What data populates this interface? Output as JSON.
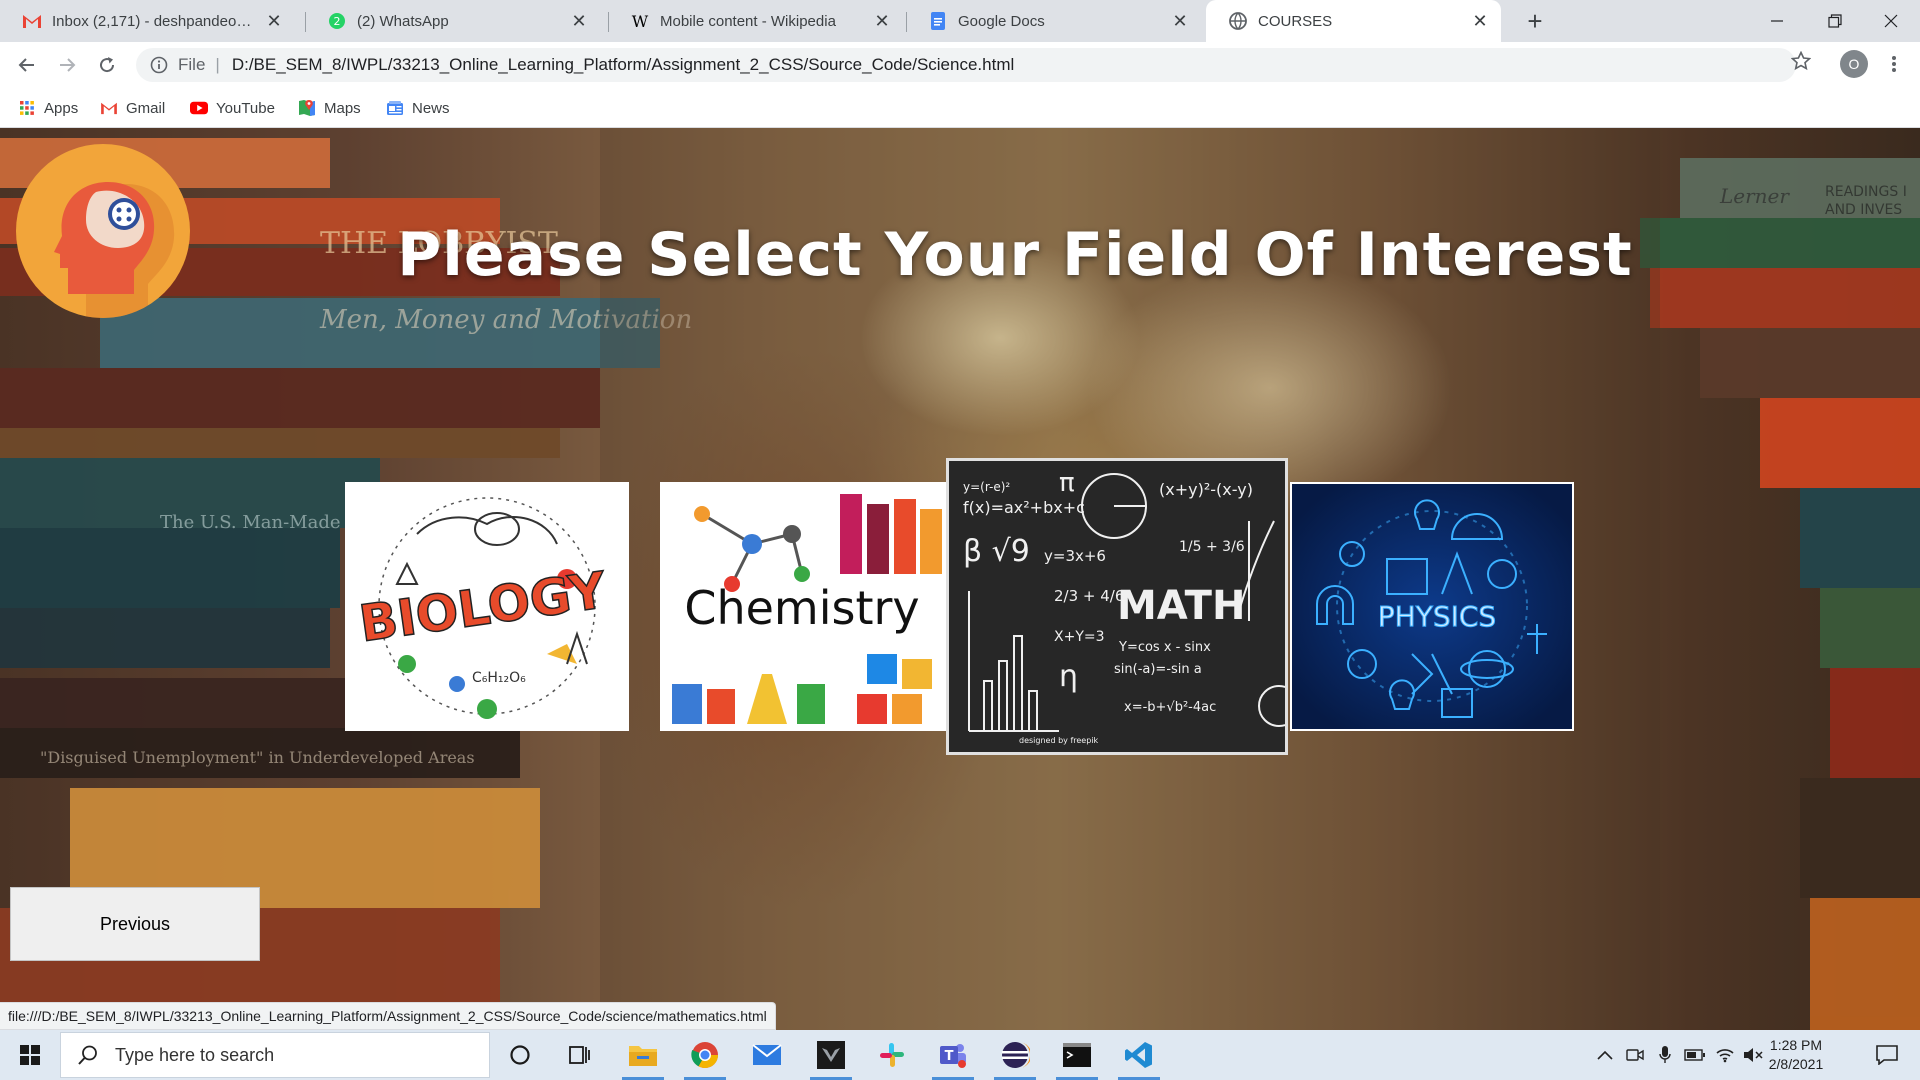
{
  "browser": {
    "tabs": [
      {
        "title": "Inbox (2,171) - deshpandeomkar",
        "icon": "gmail-icon"
      },
      {
        "title": "(2) WhatsApp",
        "icon": "whatsapp-icon"
      },
      {
        "title": "Mobile content - Wikipedia",
        "icon": "wikipedia-icon"
      },
      {
        "title": "Google Docs",
        "icon": "google-docs-icon"
      },
      {
        "title": "COURSES",
        "icon": "globe-icon",
        "active": true
      }
    ],
    "address": {
      "scheme": "File",
      "url": "D:/BE_SEM_8/IWPL/33213_Online_Learning_Platform/Assignment_2_CSS/Source_Code/Science.html"
    },
    "profile_initial": "O",
    "bookmarks": [
      {
        "label": "Apps",
        "icon": "apps-grid-icon"
      },
      {
        "label": "Gmail",
        "icon": "gmail-icon"
      },
      {
        "label": "YouTube",
        "icon": "youtube-icon"
      },
      {
        "label": "Maps",
        "icon": "maps-icon"
      },
      {
        "label": "News",
        "icon": "news-icon"
      }
    ],
    "status_url": "file:///D:/BE_SEM_8/IWPL/33213_Online_Learning_Platform/Assignment_2_CSS/Source_Code/science/mathematics.html"
  },
  "page": {
    "title": "Please Select Your Field Of Interest",
    "cards": [
      {
        "label": "BIOLOGY"
      },
      {
        "label": "Chemistry"
      },
      {
        "label": "MATH"
      },
      {
        "label": "PHYSICS"
      }
    ],
    "previous_label": "Previous"
  },
  "taskbar": {
    "search_placeholder": "Type here to search",
    "time": "1:28 PM",
    "date": "2/8/2021"
  },
  "colors": {
    "logo_orange": "#f2a53a",
    "physics_blue": "#0a2a6a",
    "accent_blue": "#1a73e8"
  }
}
